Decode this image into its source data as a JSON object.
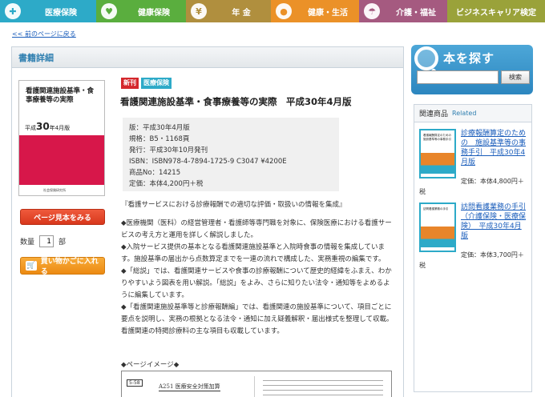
{
  "nav": {
    "items": [
      {
        "label": "医療保険",
        "icon": "cross-icon"
      },
      {
        "label": "健康保険",
        "icon": "heart-icon"
      },
      {
        "label": "年 金",
        "icon": "yen-icon"
      },
      {
        "label": "健康・生活",
        "icon": "apple-icon"
      },
      {
        "label": "介護・福祉",
        "icon": "umbrella-icon"
      },
      {
        "label": "ビジネスキャリア検定"
      }
    ]
  },
  "back_link": "<< 前のページに戻る",
  "main": {
    "header": "書籍詳細",
    "cover": {
      "title": "看護関連施設基準・食事療養等の実際",
      "band_prefix": "平成",
      "band_num": "30",
      "band_suffix": "年4月版",
      "publisher": "社会保険研究所"
    },
    "sample_button": "ページ見本をみる",
    "qty_label": "数量",
    "qty_value": "1",
    "qty_unit": "部",
    "cart_button": "買い物かごに入れる",
    "badges": {
      "new": "新刊",
      "category": "医療保険"
    },
    "title": "看護関連施設基準・食事療養等の実際　平成30年4月版",
    "specs": [
      "版：平成30年4月版",
      "規格：B5・1168頁",
      "発行：平成30年10月発刊",
      "ISBN：ISBN978-4-7894-1725-9 C3047 ¥4200E",
      "商品No：14215",
      "定価：本体4,200円＋税"
    ],
    "description": {
      "lead": "『看護サービスにおける診療報酬での適切な評価・取扱いの情報を集成』",
      "p1": "◆医療機関（医科）の経営管理者・看護師等専門職を対象に、保険医療における看護サービスの考え方と運用を詳しく解説しました。",
      "p2": "◆入院サービス提供の基本となる看護関連施設基準と入院時食事の情報を集成しています。施設基準の届出から点数算定までを一連の流れで構成した、実務重視の編集です。",
      "p3": "◆「総説」では、看護関連サービスや食事の診療報酬について歴史的経緯をふまえ、わかりやすいよう図表を用い解説。「総説」をよみ、さらに知りたい法令・通知等をよめるように編集しています。",
      "p4": "◆「看護関連施設基準等と診療報酬編」では、看護関連の施設基準について、項目ごとに要点を説明し、実務の根拠となる法令・通知に加え疑義解釈・届出様式を整理して収載。看護関連の特掲診療料の主な項目も収載しています。"
    },
    "preview_label": "◆ページイメージ◆",
    "preview": {
      "tag": "5-58",
      "heading": "A251 医療安全対策加算"
    }
  },
  "sidebar": {
    "search_title": "本を探す",
    "search_placeholder": "",
    "search_button": "検索",
    "related_title": "関連商品",
    "related_title_en": "Related",
    "related_items": [
      {
        "thumb_title": "看護報酬算定のための施設基準等の事務手引",
        "link": "診療報酬算定のための　施設基準等の事務手引　平成30年4月版",
        "price": "定価：本体4,800円＋",
        "tax": "税",
        "accent": "#2daac8",
        "band": "#e8852a"
      },
      {
        "thumb_title": "訪問看護業務の手引",
        "link": "訪問看護業務の手引（介護保険・医療保険）　平成30年4月版",
        "price": "定価：本体3,700円＋",
        "tax": "税",
        "accent": "#2daac8",
        "band": "#e8852a"
      }
    ]
  }
}
